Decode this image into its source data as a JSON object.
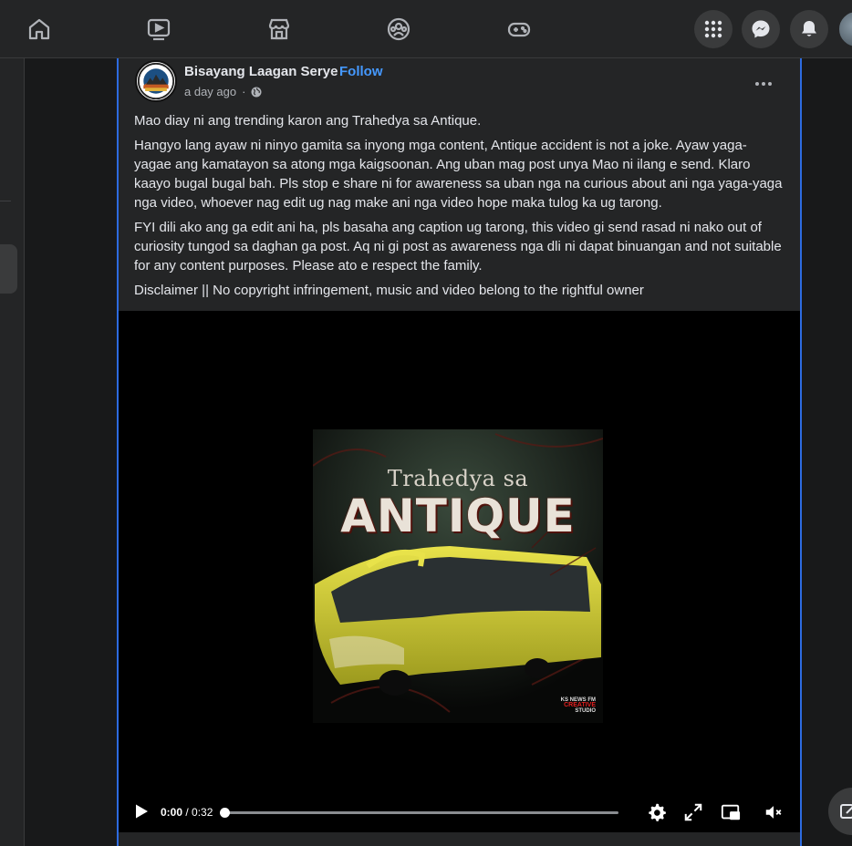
{
  "nav": {
    "items": [
      {
        "icon": "home-icon"
      },
      {
        "icon": "video-icon"
      },
      {
        "icon": "marketplace-icon"
      },
      {
        "icon": "groups-icon"
      },
      {
        "icon": "gaming-icon"
      }
    ],
    "right": [
      {
        "icon": "menu-grid-icon"
      },
      {
        "icon": "messenger-icon"
      },
      {
        "icon": "notifications-bell-icon"
      },
      {
        "icon": "profile-avatar"
      }
    ]
  },
  "post": {
    "page_name": "Bisayang Laagan Serye",
    "separator": "·",
    "follow_label": "Follow",
    "time": "a day ago",
    "meta_dot": "·",
    "privacy_icon": "globe-icon",
    "paragraphs": [
      "Mao diay ni ang trending karon ang Trahedya sa Antique.",
      "Hangyo lang ayaw ni ninyo gamita sa inyong mga content, Antique accident is not a joke. Ayaw yaga-yagae ang kamatayon sa atong mga kaigsoonan. Ang uban mag post unya Mao ni ilang e send. Klaro kaayo bugal bugal bah. Pls stop e share ni for awareness sa uban nga na curious about ani nga yaga-yaga nga video,  whoever nag edit ug nag make ani nga video hope maka tulog ka ug tarong.",
      "FYI dili ako ang ga edit ani ha, pls basaha ang caption ug tarong, this video gi send rasad ni nako out of curiosity tungod sa daghan ga post. Aq ni gi post as awareness nga dli ni dapat binuangan and not suitable for any content purposes. Please ato e respect the family.",
      "Disclaimer || No copyright infringement, music and video belong to the rightful owner"
    ]
  },
  "video": {
    "thumbnail": {
      "title_line1": "Trahedya sa",
      "title_line2": "ANTIQUE",
      "brand_line1": "KS NEWS FM",
      "brand_line2": "CREATIVE",
      "brand_line3": "STUDIO"
    },
    "current_time": "0:00",
    "time_separator": " / ",
    "duration": "0:32",
    "progress": 0,
    "controls": [
      "play-icon",
      "settings-gear-icon",
      "fullscreen-expand-icon",
      "picture-in-picture-icon",
      "volume-muted-icon"
    ]
  }
}
